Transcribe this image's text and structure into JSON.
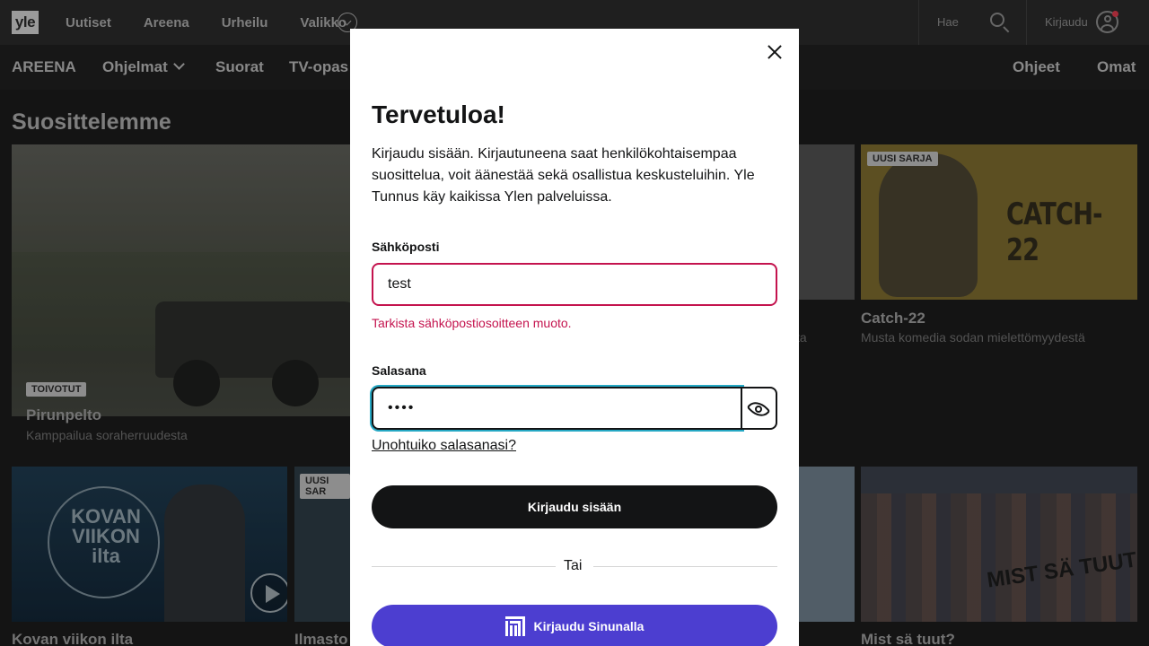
{
  "topbar": {
    "logo": "yle",
    "nav": [
      "Uutiset",
      "Areena",
      "Urheilu",
      "Valikko"
    ],
    "search_label": "Hae",
    "login_label": "Kirjaudu"
  },
  "areena_nav": {
    "brand": "AREENA",
    "items": [
      "Ohjelmat",
      "Suorat",
      "TV-opas"
    ],
    "right": [
      "Ohjeet",
      "Omat"
    ]
  },
  "content": {
    "section_title": "Suosittelemme",
    "hero": {
      "badge": "TOIVOTUT",
      "title": "Pirunpelto",
      "subtitle": "Kamppailua soraherruudesta"
    },
    "catch": {
      "badge": "UUSI SARJA",
      "logo": "CATCH-22",
      "title": "Catch-22",
      "subtitle": "Musta komedia sodan mielettömyydestä"
    },
    "middle_sub_fragment": "sta",
    "kovan": {
      "logo": "KOVAN VIIKON ilta",
      "title": "Kovan viikon ilta"
    },
    "ilmasto": {
      "badge": "UUSI SAR",
      "title": "Ilmasto"
    },
    "mist": {
      "logo": "MIST SÄ TUUT",
      "title": "Mist sä tuut?"
    }
  },
  "modal": {
    "heading": "Tervetuloa!",
    "intro": "Kirjaudu sisään. Kirjautuneena saat henkilökohtaisempaa suosittelua, voit äänestää sekä osallistua keskusteluihin. Yle Tunnus käy kaikissa Ylen palveluissa.",
    "email_label": "Sähköposti",
    "email_value": "test",
    "email_error": "Tarkista sähköpostiosoitteen muoto.",
    "password_label": "Salasana",
    "password_value": "••••",
    "forgot": "Unohtuiko salasanasi?",
    "login_button": "Kirjaudu sisään",
    "or": "Tai",
    "sinuna_button": "Kirjaudu Sinunalla"
  },
  "colors": {
    "error": "#c4134e",
    "focus": "#25a8c4",
    "sinuna": "#4c3ed0"
  }
}
